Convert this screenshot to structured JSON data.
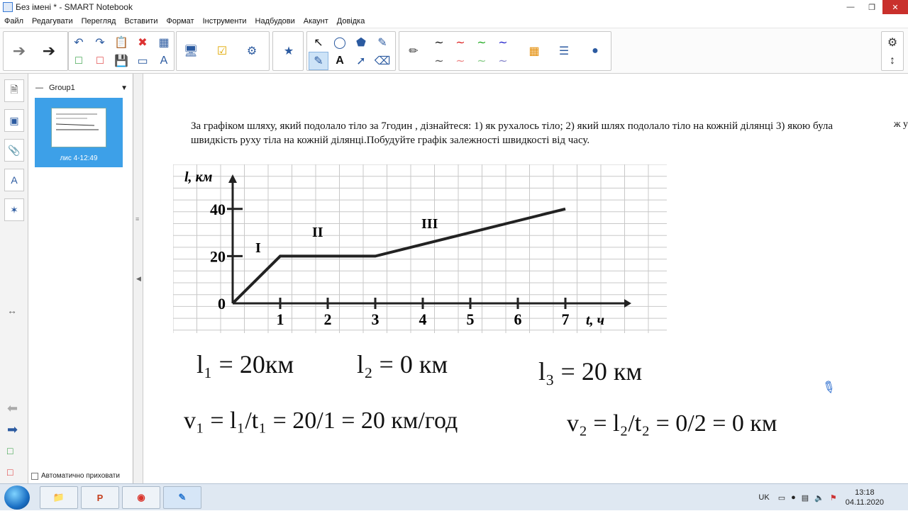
{
  "window": {
    "title": "Без імені * - SMART Notebook"
  },
  "menu": [
    "Файл",
    "Редагувати",
    "Перегляд",
    "Вставити",
    "Формат",
    "Інструменти",
    "Надбудови",
    "Акаунт",
    "Довідка"
  ],
  "page_panel": {
    "group_name": "Group1",
    "thumbnail_label": "лис 4-12:49",
    "auto_hide_label": "Автоматично приховати"
  },
  "question": "За графіком шляху, який подолало тіло за 7годин , дізнайтеся: 1) як рухалось тіло; 2) який шлях подолало тіло на кожній ділянці 3) якою була швидкість руху тіла на кожній ділянці.Побудуйте графік залежності швидкості від часу.",
  "question_overflow": "ж у",
  "graph": {
    "y_label": "l, км",
    "x_label": "t, ч",
    "segments": [
      "I",
      "II",
      "III"
    ]
  },
  "chart_data": {
    "type": "line",
    "title": "",
    "xlabel": "t, ч",
    "ylabel": "l, км",
    "x_ticks": [
      1,
      2,
      3,
      4,
      5,
      6,
      7
    ],
    "y_ticks": [
      0,
      20,
      40
    ],
    "xlim": [
      0,
      8
    ],
    "ylim": [
      0,
      45
    ],
    "grid": true,
    "series": [
      {
        "x": [
          0,
          1,
          3,
          7
        ],
        "y": [
          0,
          20,
          20,
          40
        ]
      }
    ],
    "annotations": [
      "I",
      "II",
      "III"
    ]
  },
  "handwriting": {
    "line1": [
      "l₁ = 20км",
      "l₂ = 0 км",
      "l₃ = 20 км"
    ],
    "line2": [
      "v₁ = l₁/t₁ = 20/1 = 20 км/год",
      "v₂ = l₂/t₂ = 0/2 = 0 км"
    ]
  },
  "taskbar": {
    "lang": "UK",
    "time": "13:18",
    "date": "04.11.2020"
  },
  "colors": {
    "accent": "#3da0e8",
    "toolbar_icon": "#2b5aa0",
    "close": "#c9302c"
  }
}
